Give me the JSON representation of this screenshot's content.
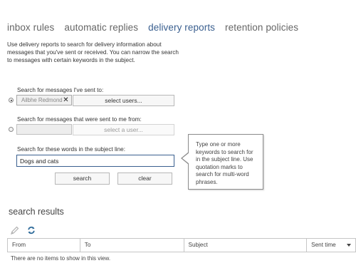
{
  "tabs": [
    {
      "label": "inbox rules",
      "active": false
    },
    {
      "label": "automatic replies",
      "active": false
    },
    {
      "label": "delivery reports",
      "active": true
    },
    {
      "label": "retention policies",
      "active": false
    }
  ],
  "intro": {
    "line1": "Use delivery reports to search for delivery information about",
    "line2": "messages that you've sent or received. You can narrow the search",
    "line3": "to messages with certain keywords in the subject."
  },
  "sent_to": {
    "label": "Search for messages I've sent to:",
    "selected": true,
    "user_value": "Ailbhe Redmond",
    "remove_icon": "close-icon",
    "button_label": "select users..."
  },
  "sent_by": {
    "label": "Search for messages that were sent to me from:",
    "selected": false,
    "button_label": "select a user..."
  },
  "subject": {
    "label": "Search for these words in the subject line:",
    "value": "Dogs and cats"
  },
  "buttons": {
    "search": "search",
    "clear": "clear"
  },
  "tooltip": {
    "lines": [
      "Type one or more",
      "keywords to search for",
      "in the subject line. Use",
      "quotation marks to",
      "search for multi-word",
      "phrases."
    ]
  },
  "results": {
    "heading": "search results",
    "toolbar_icons": [
      "pencil-icon",
      "refresh-icon"
    ],
    "columns": [
      "From",
      "To",
      "Subject",
      "Sent time"
    ],
    "sorted_column_icon": "chevron-down-icon",
    "empty_message": "There are no items to show in this view."
  },
  "colors": {
    "accent": "#3a5f8f",
    "refresh_icon": "#2f6b9a"
  }
}
